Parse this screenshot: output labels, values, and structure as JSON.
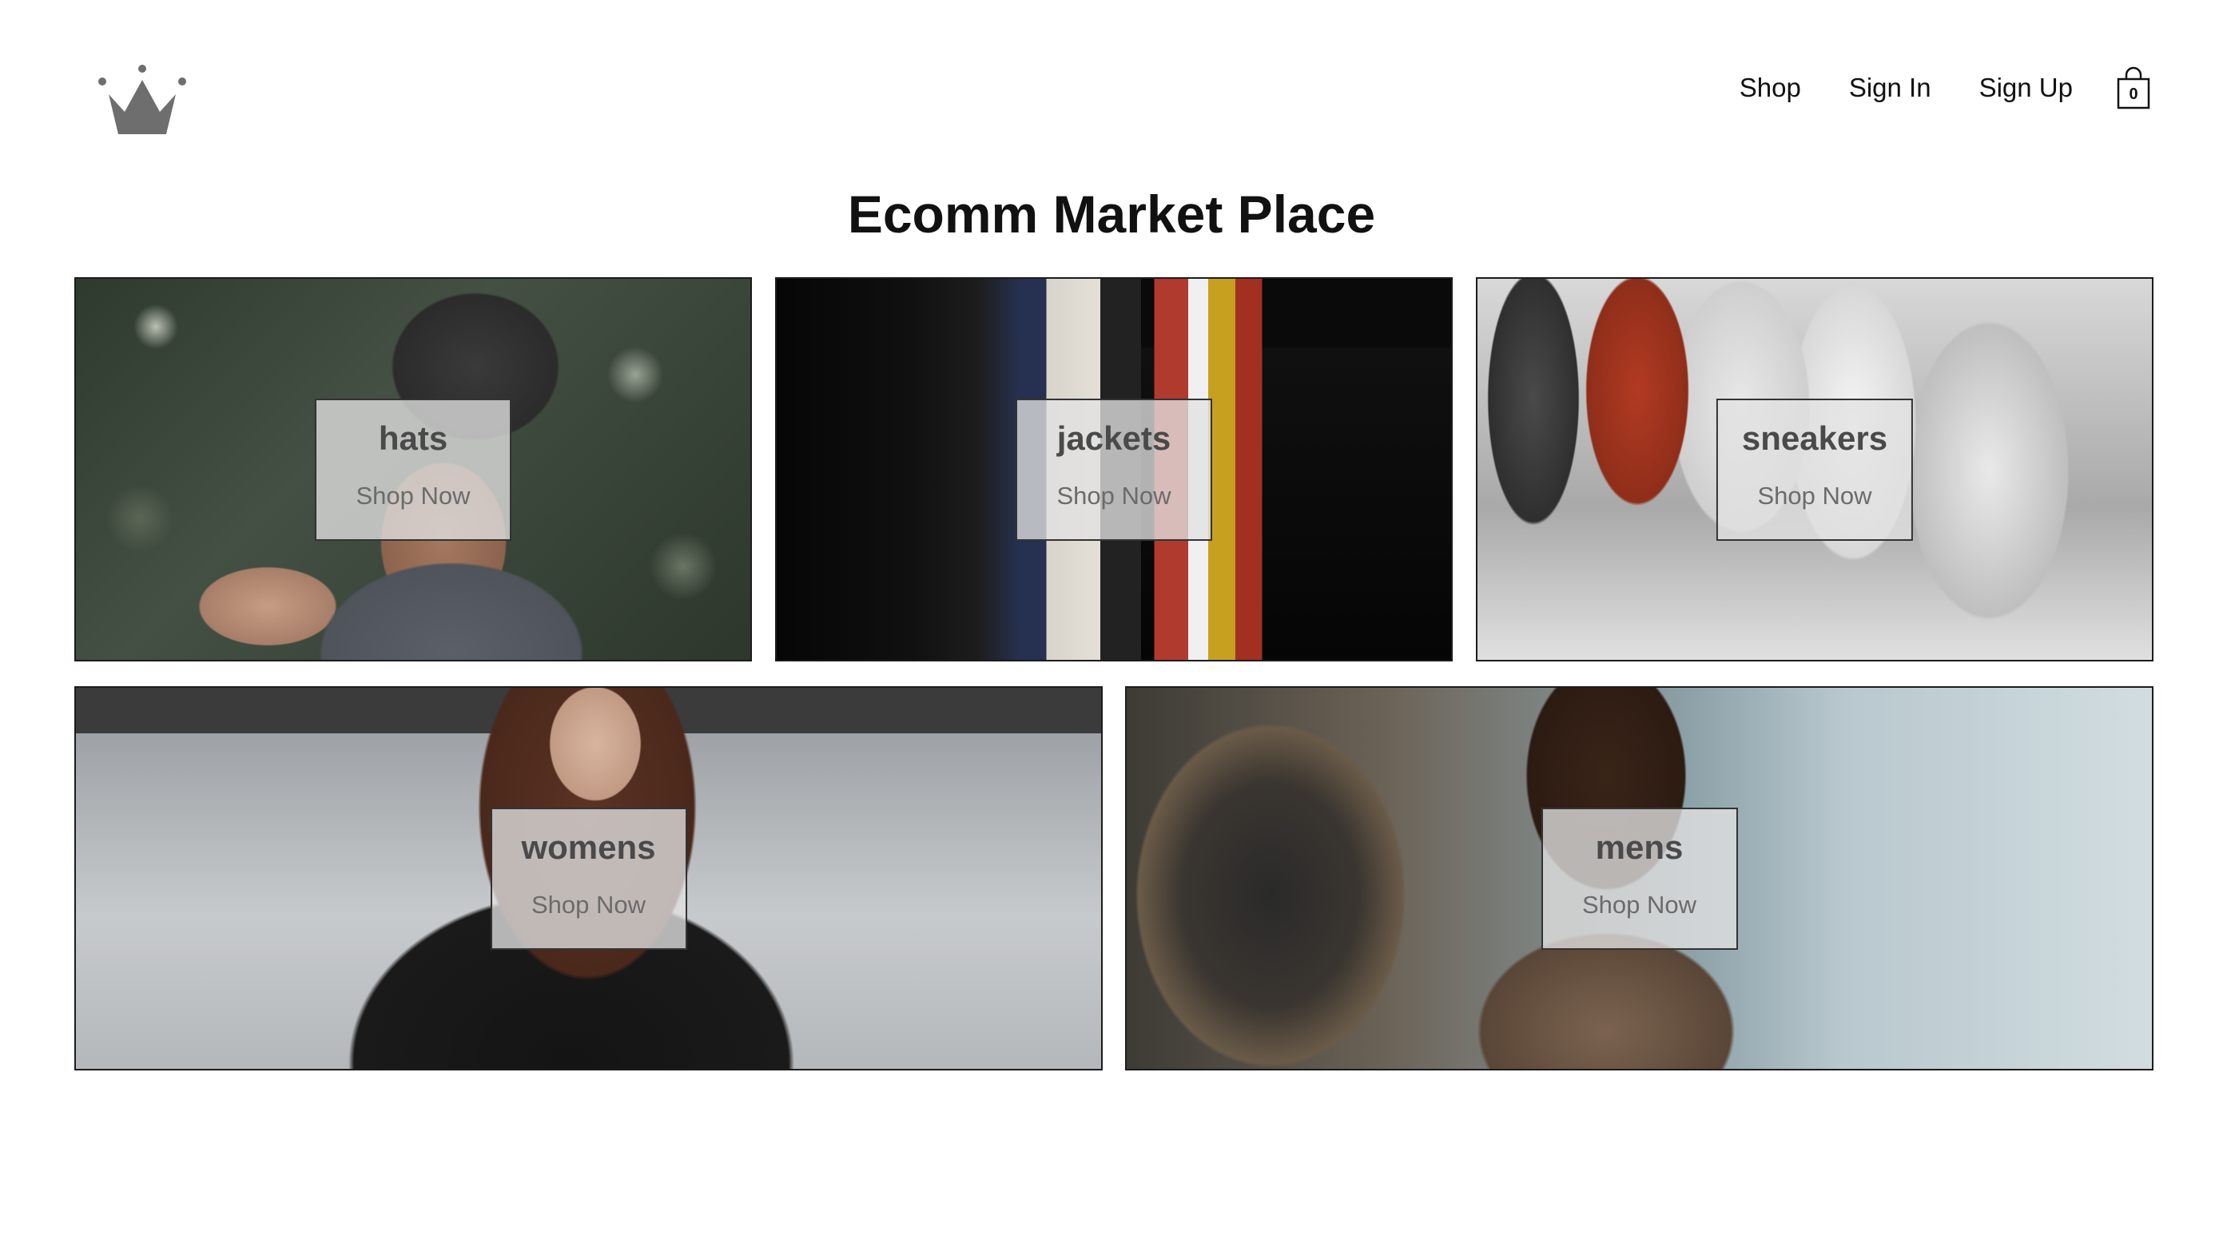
{
  "header": {
    "logo_icon": "crown-icon",
    "nav": {
      "shop": "Shop",
      "sign_in": "Sign In",
      "sign_up": "Sign Up"
    },
    "cart": {
      "icon": "shopping-bag-icon",
      "count": "0"
    }
  },
  "page": {
    "title": "Ecomm Market Place"
  },
  "categories": [
    {
      "name": "hats",
      "cta": "Shop Now"
    },
    {
      "name": "jackets",
      "cta": "Shop Now"
    },
    {
      "name": "sneakers",
      "cta": "Shop Now"
    },
    {
      "name": "womens",
      "cta": "Shop Now"
    },
    {
      "name": "mens",
      "cta": "Shop Now"
    }
  ],
  "colors": {
    "text": "#111111",
    "tile_border": "#1c1c1c",
    "overlay_bg": "#e1e1e1",
    "overlay_name": "#4a4a4a",
    "overlay_cta": "#6b6b6b",
    "logo": "#6e6e6e"
  }
}
